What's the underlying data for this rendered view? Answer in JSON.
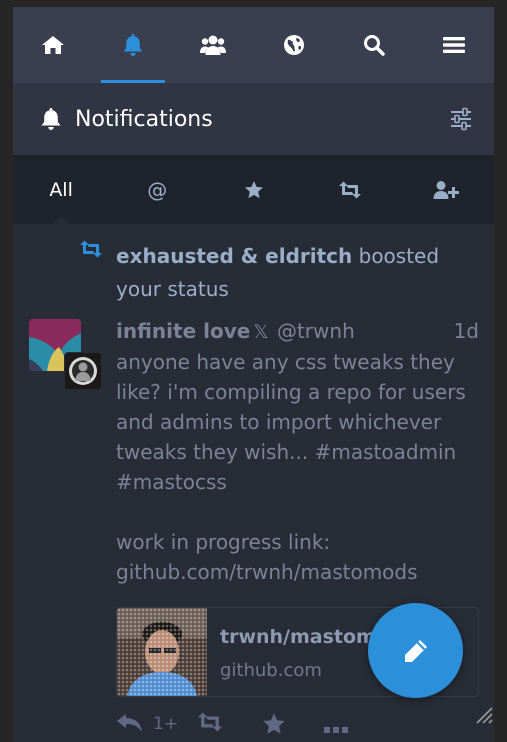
{
  "nav": {
    "items": [
      {
        "name": "home",
        "icon": "home-icon"
      },
      {
        "name": "notifications",
        "icon": "bell-icon",
        "active": true
      },
      {
        "name": "local",
        "icon": "users-icon"
      },
      {
        "name": "federated",
        "icon": "globe-icon"
      },
      {
        "name": "search",
        "icon": "search-icon"
      },
      {
        "name": "menu",
        "icon": "menu-icon"
      }
    ],
    "accent": "#2b90d9"
  },
  "header": {
    "title": "Notifications",
    "icon": "bell-icon",
    "settings_icon": "sliders-icon"
  },
  "filters": {
    "all_label": "All",
    "mentions_label": "@",
    "icons": [
      "star-icon",
      "retweet-icon",
      "user-plus-icon"
    ],
    "active": "All"
  },
  "notification": {
    "booster": "exhausted & eldritch",
    "action_text": "boosted your status",
    "status": {
      "display_name": "infinite love",
      "x_glyph": "𝕏",
      "account": "@trwnh",
      "time": "1d",
      "paragraph1": "anyone have any css tweaks they like? i'm compiling a repo for users and admins to import whichever tweaks they wish... #mastoadmin #mastocss",
      "paragraph2": "work in progress link: github.com/trwnh/mastomods",
      "card": {
        "title": "trwnh/mastomods",
        "host": "github.com"
      },
      "reply_count": "1+"
    }
  },
  "fab": {
    "icon": "pencil-icon"
  }
}
